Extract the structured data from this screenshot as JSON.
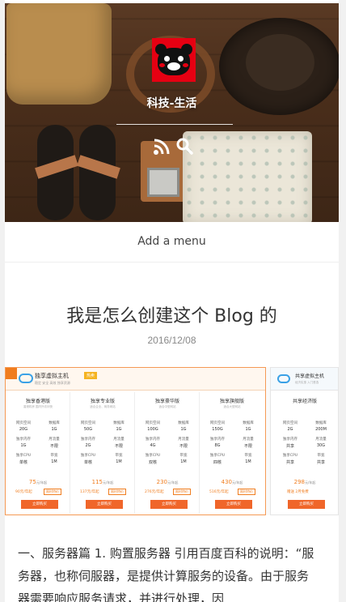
{
  "site": {
    "title": "科技-生活"
  },
  "icons": {
    "rss": "rss-icon",
    "search": "search-icon",
    "avatar": "kumamon-bear-avatar"
  },
  "menu": {
    "label": "Add a menu"
  },
  "post": {
    "title": "我是怎么创建这个 Blog 的",
    "date": "2016/12/08",
    "excerpt": "一、服务器篇 1. 购置服务器 引用百度百科的说明：“服务器，也称伺服器，是提供计算服务的设备。由于服务器需要响应服务请求，并进行处理，因"
  },
  "server_image": {
    "main_title": "独享虚拟主机",
    "main_badge": "热卖",
    "main_sub": "稳定 安全 高效 独享资源",
    "plans": [
      {
        "name": "独享香港版",
        "sub": "香港机房 国内外访问快",
        "space": "20G",
        "db": "1G",
        "ip": "1G",
        "traffic": "不限",
        "cpu": "单核",
        "bw": "1M",
        "price": "75",
        "orig": "90元/年起",
        "chip": "限时特价",
        "btn": "立即购买"
      },
      {
        "name": "独享专业版",
        "sub": "适合企业、商务网站",
        "space": "50G",
        "db": "1G",
        "ip": "2G",
        "traffic": "不限",
        "cpu": "单核",
        "bw": "1M",
        "price": "115",
        "orig": "137元/年起",
        "chip": "限时特价",
        "btn": "立即购买"
      },
      {
        "name": "独享豪华版",
        "sub": "适合中型网站",
        "space": "100G",
        "db": "1G",
        "ip": "4G",
        "traffic": "不限",
        "cpu": "双核",
        "bw": "1M",
        "price": "230",
        "orig": "276元/年起",
        "chip": "限时特价",
        "btn": "立即购买"
      },
      {
        "name": "独享旗舰版",
        "sub": "适合大型网站",
        "space": "150G",
        "db": "1G",
        "ip": "8G",
        "traffic": "不限",
        "cpu": "四核",
        "bw": "1M",
        "price": "430",
        "orig": "516元/年起",
        "chip": "限时特价",
        "btn": "立即购买"
      }
    ],
    "spec_labels": {
      "space": "网页空间",
      "db": "数据库",
      "ip": "独享内存",
      "traffic": "月流量",
      "cpu": "独享CPU",
      "bw": "带宽"
    },
    "price_unit": "元/年起",
    "side": {
      "title": "共享虚拟主机",
      "sub": "经济实惠 入门首选",
      "plan_name": "共享经济版",
      "space": "2G",
      "db": "200M",
      "ip": "共享",
      "traffic": "30G",
      "cpu": "共享",
      "bw": "共享",
      "price": "298",
      "note": "赠送 2月免费",
      "btn": "立即购买"
    }
  },
  "colors": {
    "accent": "#f07d1f",
    "button": "#f0662a",
    "avatar_red": "#e60012"
  }
}
